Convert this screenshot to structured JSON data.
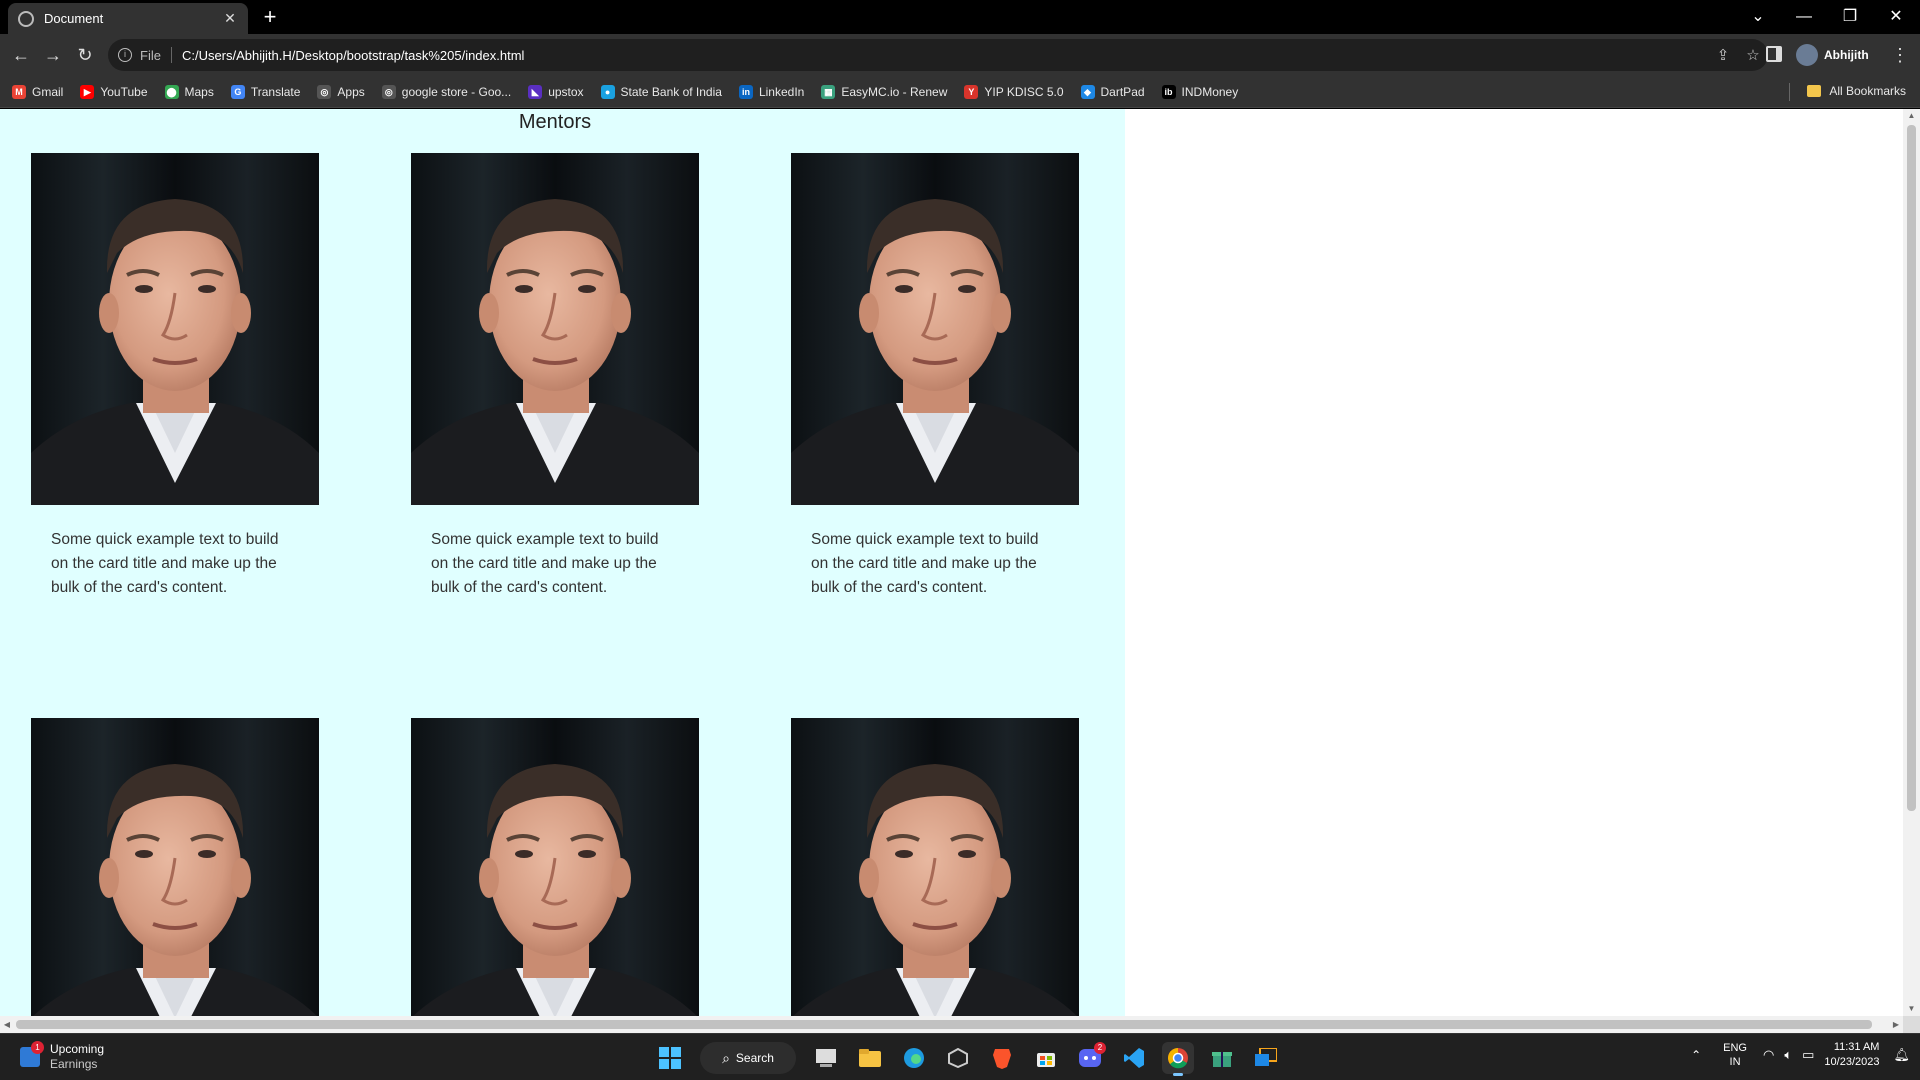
{
  "browser": {
    "tab_title": "Document",
    "tab_close": "✕",
    "new_tab": "+",
    "file_label": "File",
    "url": "C:/Users/Abhijith.H/Desktop/bootstrap/task%205/index.html",
    "profile_name": "Abhijith",
    "window_controls": [
      "⌄",
      "—",
      "❐",
      "✕"
    ]
  },
  "bookmarks": {
    "items": [
      {
        "label": "Gmail",
        "icon": "gmail-icon",
        "color": "#ea4335",
        "glyph": "M"
      },
      {
        "label": "YouTube",
        "icon": "youtube-icon",
        "color": "#ff0000",
        "glyph": "▶"
      },
      {
        "label": "Maps",
        "icon": "maps-icon",
        "color": "#34a853",
        "glyph": "⬤"
      },
      {
        "label": "Translate",
        "icon": "translate-icon",
        "color": "#4285f4",
        "glyph": "G"
      },
      {
        "label": "Apps",
        "icon": "globe-icon",
        "color": "#555555",
        "glyph": "◎"
      },
      {
        "label": "google store - Goo...",
        "icon": "globe-icon",
        "color": "#555555",
        "glyph": "◎"
      },
      {
        "label": "upstox",
        "icon": "upstox-icon",
        "color": "#5a2fc2",
        "glyph": "◣"
      },
      {
        "label": "State Bank of India",
        "icon": "sbi-icon",
        "color": "#1aa1e0",
        "glyph": "●"
      },
      {
        "label": "LinkedIn",
        "icon": "linkedin-icon",
        "color": "#0a66c2",
        "glyph": "in"
      },
      {
        "label": "EasyMC.io - Renew",
        "icon": "easymc-icon",
        "color": "#3aa17e",
        "glyph": "▦"
      },
      {
        "label": "YIP KDISC 5.0",
        "icon": "yip-icon",
        "color": "#d9342b",
        "glyph": "Y"
      },
      {
        "label": "DartPad",
        "icon": "dart-icon",
        "color": "#1e88e5",
        "glyph": "◆"
      },
      {
        "label": "INDMoney",
        "icon": "indmoney-icon",
        "color": "#000000",
        "glyph": "ib"
      }
    ],
    "all_bookmarks": "All Bookmarks"
  },
  "page": {
    "heading": "Mentors",
    "background": "#e0ffff",
    "cards": [
      {
        "text": "Some quick example text to build on the card title and make up the bulk of the card's content."
      },
      {
        "text": "Some quick example text to build on the card title and make up the bulk of the card's content."
      },
      {
        "text": "Some quick example text to build on the card title and make up the bulk of the card's content."
      },
      {
        "text": ""
      },
      {
        "text": ""
      },
      {
        "text": ""
      }
    ]
  },
  "taskbar": {
    "widget_title": "Upcoming",
    "widget_subtitle": "Earnings",
    "widget_badge": "1",
    "search_label": "Search",
    "discord_badge": "2",
    "lang_top": "ENG",
    "lang_bottom": "IN",
    "time": "11:31 AM",
    "date": "10/23/2023"
  }
}
